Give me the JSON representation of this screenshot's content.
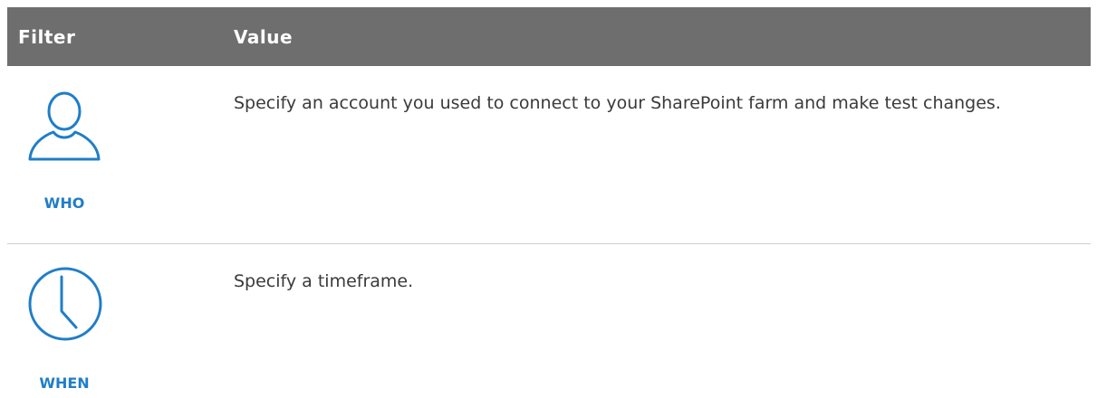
{
  "table": {
    "header": {
      "filter": "Filter",
      "value": "Value"
    },
    "rows": [
      {
        "icon": "user-icon",
        "filter": "WHO",
        "value": "Specify an account you used to connect to your SharePoint farm and make test changes."
      },
      {
        "icon": "clock-icon",
        "filter": "WHEN",
        "value": "Specify a timeframe."
      }
    ]
  },
  "colors": {
    "header_bg": "#6e6e6e",
    "header_text": "#ffffff",
    "accent": "#1f7ec8",
    "body_text": "#3a3a3a",
    "divider": "#cfcfcf"
  }
}
